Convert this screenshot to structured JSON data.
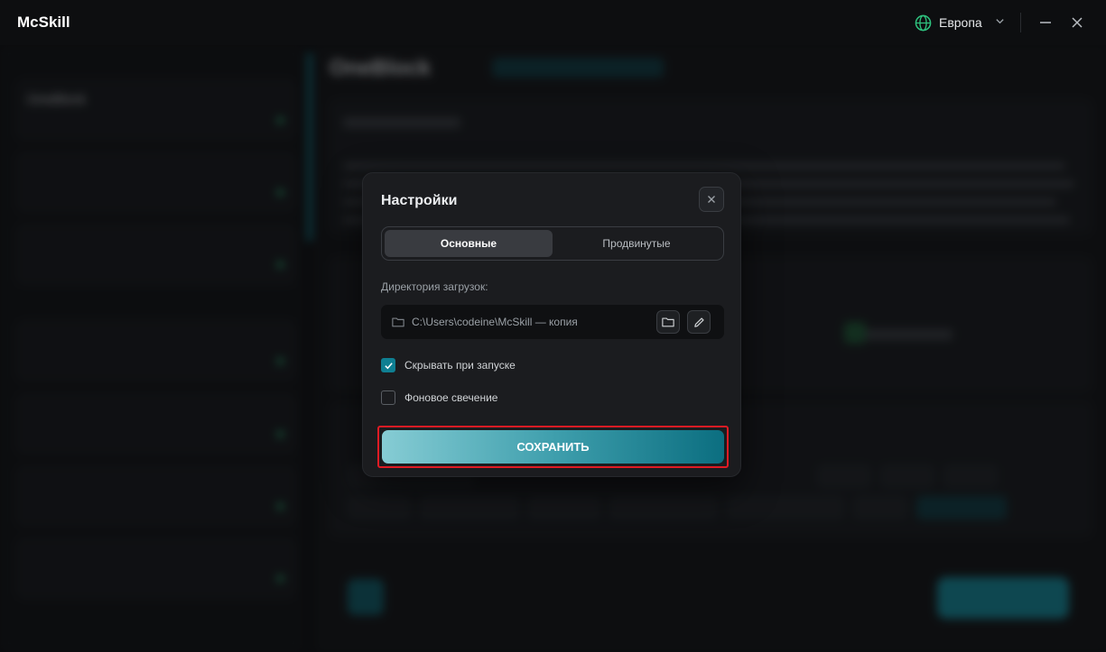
{
  "app": {
    "title": "McSkill"
  },
  "titlebar": {
    "region_label": "Европа"
  },
  "background": {
    "sidebar": {
      "items": [
        {
          "name": "OneBlock",
          "tag": "",
          "sub": "",
          "online": ""
        },
        {
          "name": "",
          "tag": "",
          "sub": "",
          "online": ""
        },
        {
          "name": "",
          "tag": "",
          "sub": "",
          "online": ""
        },
        {
          "name": "",
          "tag": "",
          "sub": "",
          "online": ""
        },
        {
          "name": "",
          "tag": "",
          "sub": "",
          "online": ""
        },
        {
          "name": "",
          "tag": "",
          "sub": "",
          "online": ""
        },
        {
          "name": "",
          "tag": "",
          "sub": "",
          "online": ""
        }
      ]
    },
    "main": {
      "title": "OneBlock"
    }
  },
  "modal": {
    "title": "Настройки",
    "tabs": [
      {
        "label": "Основные",
        "active": true
      },
      {
        "label": "Продвинутые",
        "active": false
      }
    ],
    "download_dir_label": "Директория загрузок:",
    "download_dir_value": "C:\\Users\\codeine\\McSkill — копия",
    "options": [
      {
        "label": "Скрывать при запуске",
        "checked": true
      },
      {
        "label": "Фоновое свечение",
        "checked": false
      }
    ],
    "save_label": "СОХРАНИТЬ"
  },
  "colors": {
    "accent": "#0f7f92",
    "region_globe": "#2ec27e",
    "highlight_border": "#e01b24"
  },
  "icons": {
    "region": "globe-icon",
    "dropdown": "chevron-down-icon",
    "minimize": "minimize-icon",
    "close": "close-icon",
    "folder": "folder-icon",
    "edit": "pencil-icon",
    "check": "check-icon"
  }
}
